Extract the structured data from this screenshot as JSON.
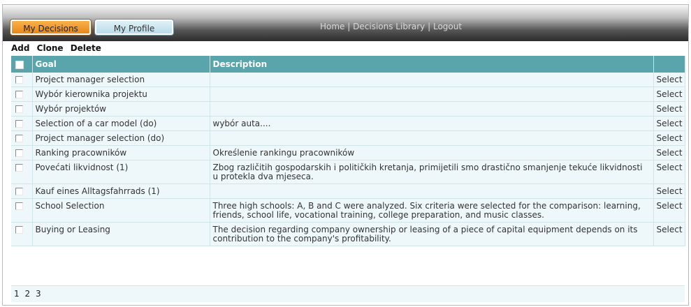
{
  "header": {
    "tabs": [
      "My Decisions",
      "My Profile"
    ],
    "nav": {
      "home": "Home",
      "library": "Decisions Library",
      "logout": "Logout",
      "sep": "|"
    }
  },
  "actions": {
    "add": "Add",
    "clone": "Clone",
    "delete": "Delete"
  },
  "table": {
    "columns": {
      "goal": "Goal",
      "description": "Description",
      "action": ""
    },
    "select_label": "Select",
    "rows": [
      {
        "goal": "Project manager selection",
        "description": ""
      },
      {
        "goal": "Wybór kierownika projektu",
        "description": ""
      },
      {
        "goal": "Wybór projektów",
        "description": ""
      },
      {
        "goal": "Selection of a car model (do)",
        "description": "wybór auta...."
      },
      {
        "goal": "Project manager selection (do)",
        "description": ""
      },
      {
        "goal": "Ranking pracowników",
        "description": "Określenie rankingu pracowników"
      },
      {
        "goal": "Povećati likvidnost (1)",
        "description": "Zbog različitih gospodarskih i političkih kretanja, primijetili smo drastično smanjenje tekuće likvidnosti u protekla dva mjeseca."
      },
      {
        "goal": "Kauf eines Alltagsfahrrads (1)",
        "description": ""
      },
      {
        "goal": "School Selection",
        "description": "Three high schools: A, B and C were analyzed. Six criteria were selected for the comparison: learning, friends, school life, vocational training, college preparation, and music classes."
      },
      {
        "goal": "Buying or Leasing",
        "description": "The decision regarding company ownership or leasing of a piece of capital equipment depends on its contribution to the company's profitability."
      }
    ]
  },
  "pager": {
    "pages": [
      "1",
      "2",
      "3"
    ]
  }
}
